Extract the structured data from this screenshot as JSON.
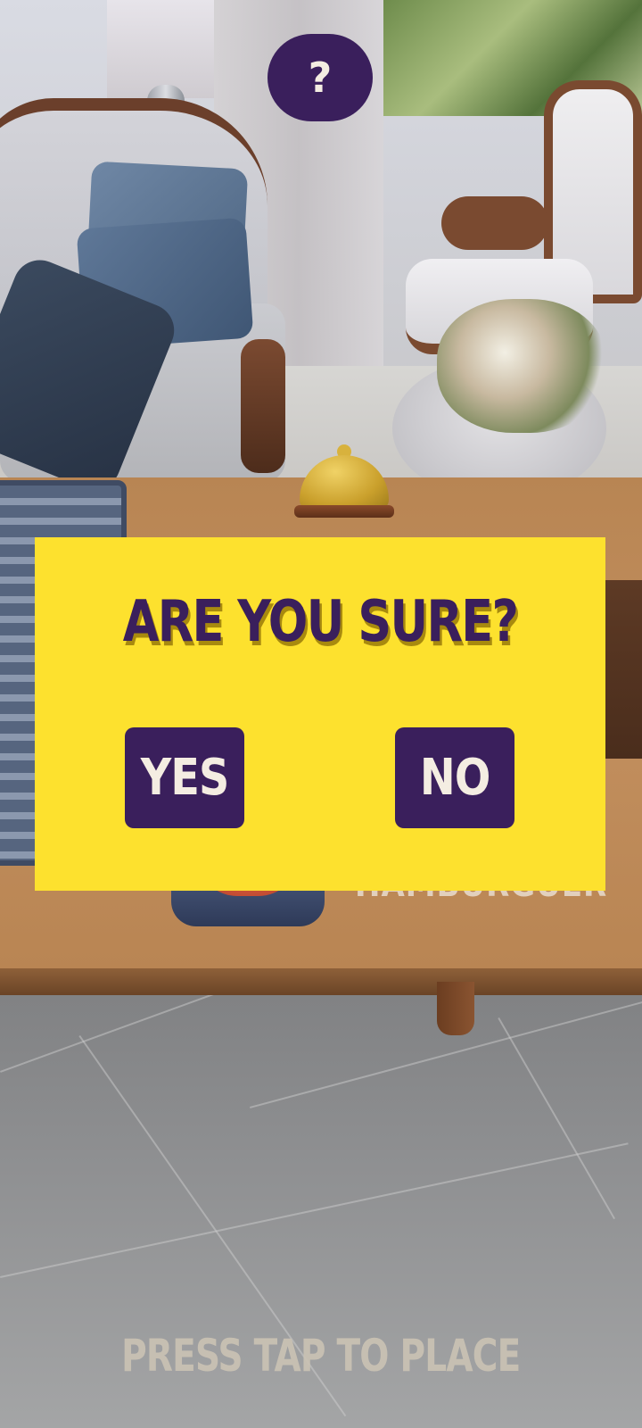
{
  "help_button": {
    "label": "?"
  },
  "dialog": {
    "title": "ARE YOU SURE?",
    "yes_label": "YES",
    "no_label": "NO"
  },
  "scene": {
    "dish_label": "HAMBURGUER"
  },
  "hint": {
    "text": "PRESS TAP TO PLACE"
  },
  "colors": {
    "accent_purple": "#3a1f5c",
    "dialog_yellow": "#fde12e",
    "button_text": "#f4ede2"
  }
}
